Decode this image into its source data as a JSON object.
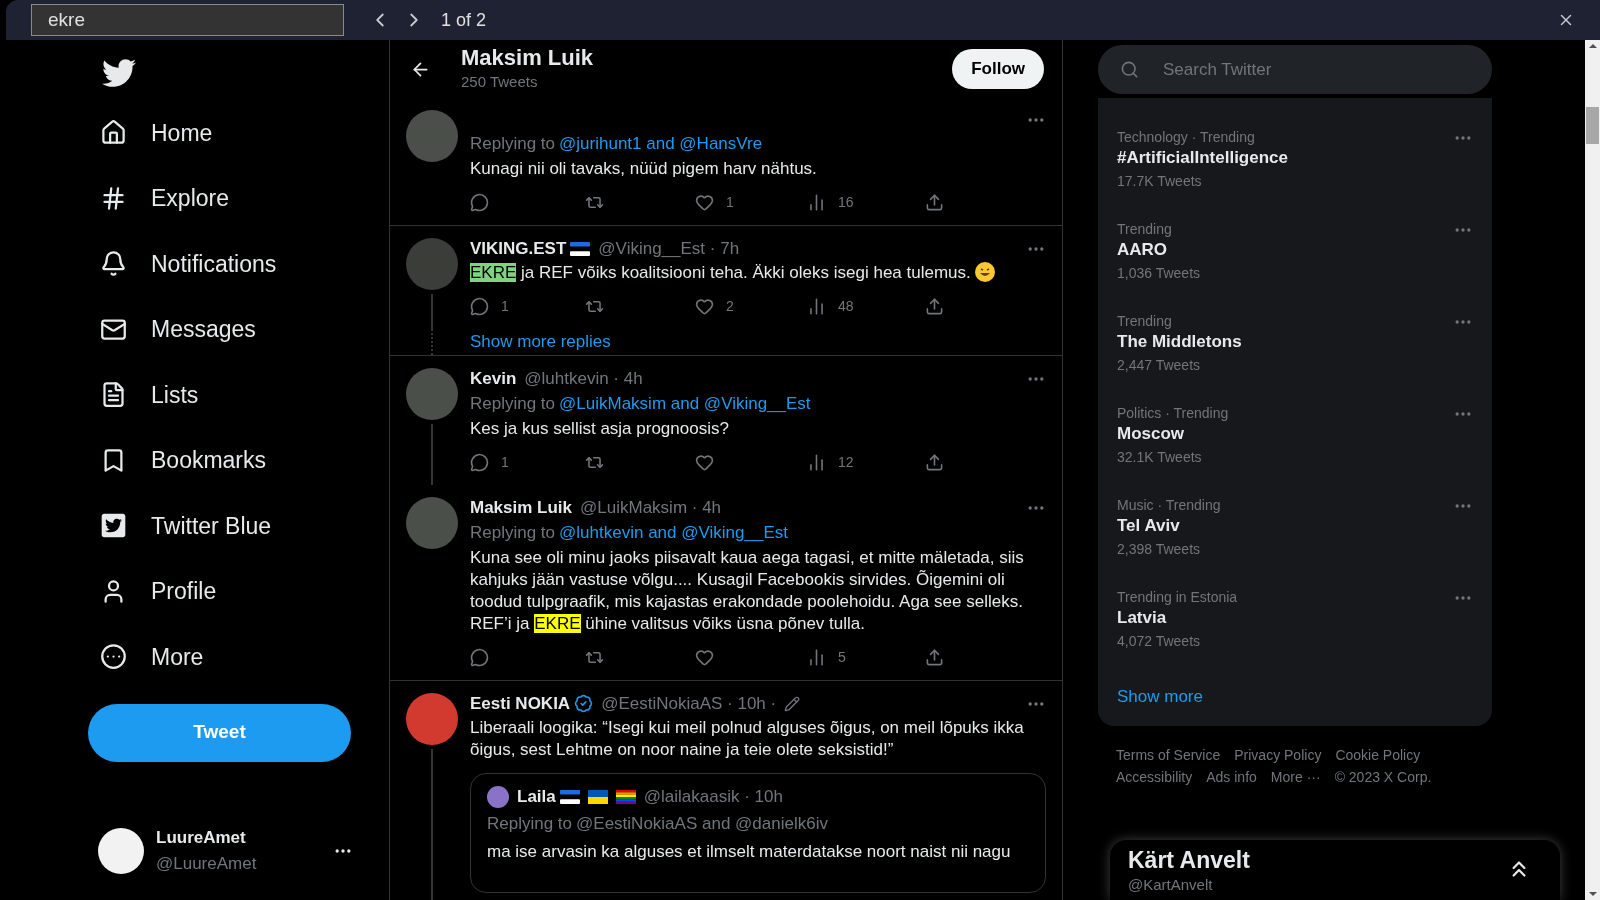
{
  "find_bar": {
    "query": "ekre",
    "match_count": "1 of 2"
  },
  "sidebar": {
    "nav": [
      {
        "kind": "home",
        "label": "Home"
      },
      {
        "kind": "explore",
        "label": "Explore"
      },
      {
        "kind": "notifications",
        "label": "Notifications"
      },
      {
        "kind": "messages",
        "label": "Messages"
      },
      {
        "kind": "lists",
        "label": "Lists"
      },
      {
        "kind": "bookmarks",
        "label": "Bookmarks"
      },
      {
        "kind": "blue",
        "label": "Twitter Blue"
      },
      {
        "kind": "profile",
        "label": "Profile"
      },
      {
        "kind": "more",
        "label": "More"
      }
    ],
    "tweet_button": "Tweet",
    "account": {
      "name": "LuureAmet",
      "handle": "@LuureAmet"
    }
  },
  "profile_header": {
    "name": "Maksim Luik",
    "tweet_count": "250 Tweets",
    "follow_button": "Follow"
  },
  "feed": [
    {
      "kind": "tweet",
      "thread_line": false,
      "reply_to_prefix": "Replying to",
      "reply_to": "@jurihunt1 and @HansVre",
      "body": [
        {
          "text": "Kunagi nii oli tavaks, nüüd pigem harv nähtus."
        }
      ],
      "stats": {
        "likes": "1",
        "views": "16"
      }
    },
    {
      "kind": "tweet",
      "thread_line": true,
      "author": "VIKING.EST",
      "flag": true,
      "meta": "@Viking__Est · 7h",
      "body": [
        {
          "text": "EKRE",
          "highlighted": true,
          "current_match": true
        },
        {
          "text": " ja REF võiks koalitsiooni teha. Äkki oleks isegi hea tulemus."
        }
      ],
      "emoji": true,
      "stats": {
        "replies": "1",
        "likes": "2",
        "views": "48"
      }
    },
    {
      "kind": "show_more",
      "label": "Show more replies"
    },
    {
      "kind": "tweet",
      "thread_line": true,
      "author": "Kevin",
      "meta": "@luhtkevin · 4h",
      "reply_to_prefix": "Replying to",
      "reply_to": "@LuikMaksim and @Viking__Est",
      "body": [
        {
          "text": "Kes ja kus sellist asja prognoosis?"
        }
      ],
      "stats": {
        "replies": "1",
        "views": "12"
      }
    },
    {
      "kind": "tweet",
      "thread_line": false,
      "author": "Maksim Luik",
      "meta": "@LuikMaksim · 4h",
      "reply_to_prefix": "Replying to",
      "reply_to": "@luhtkevin and @Viking__Est",
      "body": [
        {
          "text": "Kuna see oli minu jaoks piisavalt kaua aega tagasi, et mitte mäletada, siis kahjuks jään vastuse võlgu.... Kusagil Facebookis sirvides. Õigemini oli toodud tulpgraafik, mis kajastas erakondade poolehoidu. Aga see selleks. REF’i ja "
        },
        {
          "text": "EKRE",
          "highlighted": true,
          "current_match": false
        },
        {
          "text": " ühine valitsus võiks üsna põnev tulla."
        }
      ],
      "stats": {
        "views": "5"
      }
    },
    {
      "kind": "tweet",
      "thread_line": true,
      "author": "Eesti NOKIA",
      "verified": true,
      "edited": true,
      "meta": "@EestiNokiaAS · 10h ·",
      "body": [
        {
          "text": "Liberaali loogika: “Isegi kui meil polnud alguses õigus, on meil lõpuks ikka õigus, sest Lehtme on noor naine ja teie olete seksistid!”"
        }
      ],
      "quote": {
        "author": "Laila",
        "meta": "@lailakaasik · 10h",
        "reply_to_prefix": "Replying to",
        "reply_to": "@EestiNokiaAS and @danielk6iv",
        "body": "ma ise arvasin ka alguses et ilmselt materdatakse noort naist nii nagu"
      }
    }
  ],
  "search": {
    "placeholder": "Search Twitter"
  },
  "trends": [
    {
      "category": "Technology · Trending",
      "topic": "#ArtificialIntelligence",
      "count": "17.7K Tweets"
    },
    {
      "category": "Trending",
      "topic": "AARO",
      "count": "1,036 Tweets"
    },
    {
      "category": "Trending",
      "topic": "The Middletons",
      "count": "2,447 Tweets"
    },
    {
      "category": "Politics · Trending",
      "topic": "Moscow",
      "count": "32.1K Tweets"
    },
    {
      "category": "Music · Trending",
      "topic": "Tel Aviv",
      "count": "2,398 Tweets"
    },
    {
      "category": "Trending in Estonia",
      "topic": "Latvia",
      "count": "4,072 Tweets"
    }
  ],
  "trends_show_more": "Show more",
  "footer": {
    "links": [
      "Terms of Service",
      "Privacy Policy",
      "Cookie Policy",
      "Accessibility",
      "Ads info",
      "More ···"
    ],
    "copyright": "© 2023 X Corp."
  },
  "messages_drawer": {
    "name": "Kärt Anvelt",
    "handle": "@KartAnvelt"
  }
}
